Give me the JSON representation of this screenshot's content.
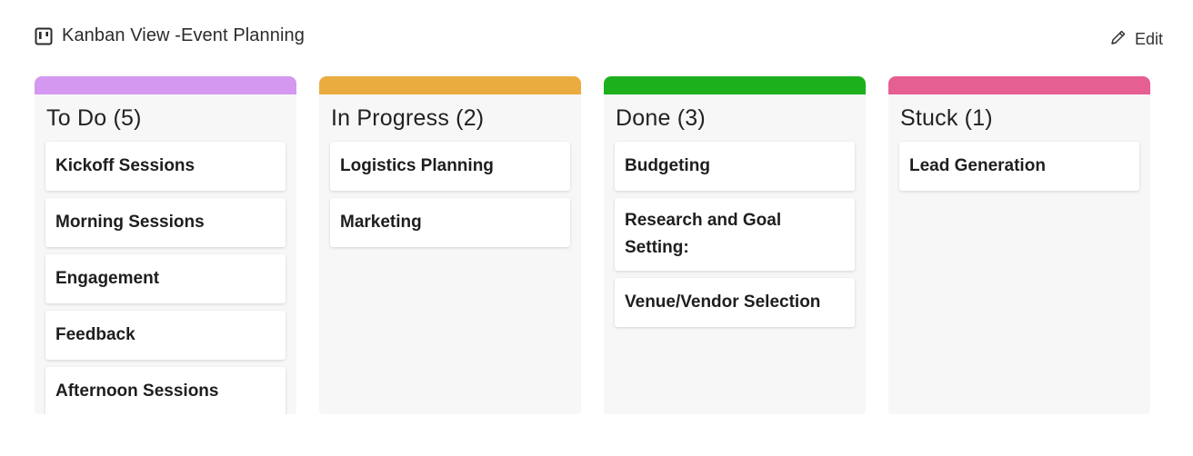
{
  "header": {
    "title": "Kanban View -Event Planning",
    "icon": "kanban-board-icon",
    "edit_label": "Edit",
    "edit_icon": "pencil-icon"
  },
  "columns": [
    {
      "title": "To Do (5)",
      "color": "#d498f0",
      "cards": [
        "Kickoff Sessions",
        "Morning Sessions",
        "Engagement",
        "Feedback",
        "Afternoon Sessions"
      ]
    },
    {
      "title": "In Progress (2)",
      "color": "#eaab3f",
      "cards": [
        "Logistics Planning",
        "Marketing"
      ]
    },
    {
      "title": "Done (3)",
      "color": "#1db01d",
      "cards": [
        "Budgeting",
        "Research and Goal Setting:",
        "Venue/Vendor Selection"
      ]
    },
    {
      "title": "Stuck (1)",
      "color": "#e65f93",
      "cards": [
        "Lead Generation"
      ]
    }
  ]
}
